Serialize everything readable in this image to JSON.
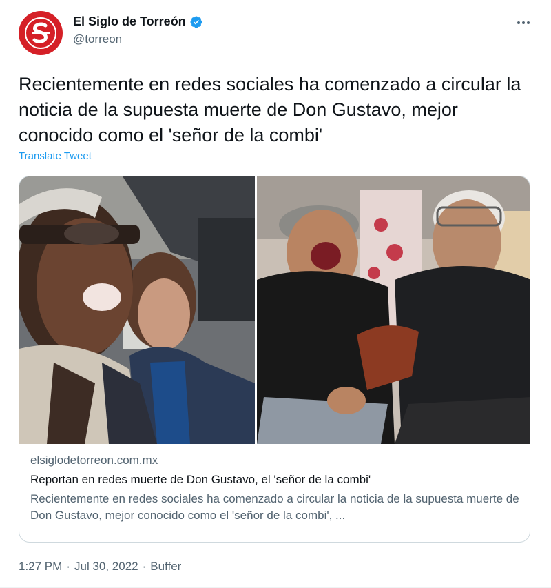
{
  "author": {
    "display_name": "El Siglo de Torreón",
    "handle": "@torreon",
    "avatar_letter": "S",
    "avatar_color": "#d52027",
    "verified_color": "#1d9bf0",
    "verified_icon": "verified-badge-icon"
  },
  "tweet": {
    "text": "Recientemente en redes sociales ha comenzado a circular la noticia de la supuesta muerte de Don Gustavo, mejor conocido como el 'señor de la combi'",
    "translate_label": "Translate Tweet"
  },
  "card": {
    "domain": "elsiglodetorreon.com.mx",
    "title": "Reportan en redes muerte de Don Gustavo, el 'señor de la combi'",
    "description": "Recientemente en redes sociales ha comenzado a circular la noticia de la supuesta muerte de Don Gustavo, mejor conocido como el 'señor de la combi', ..."
  },
  "meta": {
    "time": "1:27 PM",
    "separator1": "·",
    "date": "Jul 30, 2022",
    "separator2": "·",
    "source": "Buffer"
  },
  "colors": {
    "link": "#1d9bf0",
    "secondary_text": "#536471",
    "primary_text": "#0f1419",
    "border": "#cfd9de"
  }
}
